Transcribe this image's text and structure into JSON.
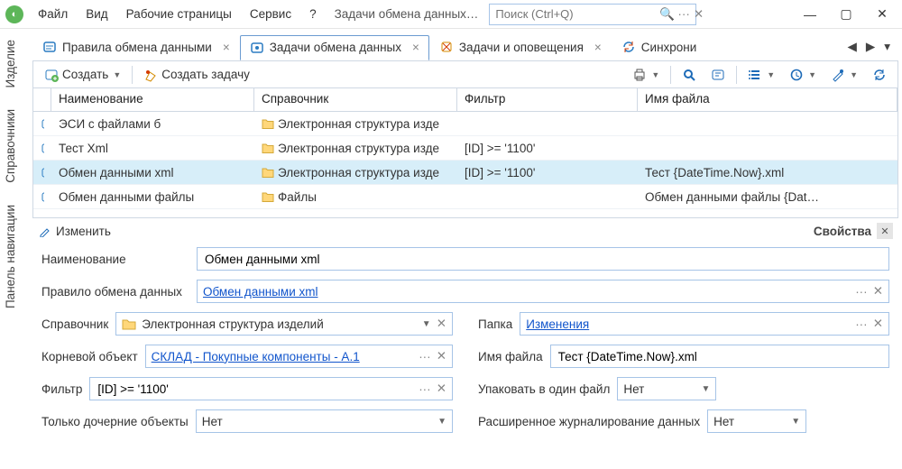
{
  "menu": {
    "file": "Файл",
    "view": "Вид",
    "pages": "Рабочие страницы",
    "service": "Сервис",
    "help": "?",
    "current": "Задачи обмена данных…"
  },
  "search": {
    "placeholder": "Поиск (Ctrl+Q)"
  },
  "window": {
    "min": "—",
    "max": "▢",
    "close": "✕"
  },
  "sidebar": {
    "items": [
      "Изделие",
      "Справочники",
      "Панель навигации"
    ]
  },
  "tabs": [
    {
      "label": "Правила обмена данными"
    },
    {
      "label": "Задачи обмена данных"
    },
    {
      "label": "Задачи и оповещения"
    },
    {
      "label": "Синхрони"
    }
  ],
  "toolbar": {
    "create": "Создать",
    "create_task": "Создать задачу"
  },
  "columns": [
    "Наименование",
    "Справочник",
    "Фильтр",
    "Имя файла"
  ],
  "rows": [
    {
      "name": "ЭСИ с файлами б",
      "ref": "Электронная структура изде",
      "filter": "",
      "file": ""
    },
    {
      "name": "Тест Xml",
      "ref": "Электронная структура изде",
      "filter": "[ID] >= '1100'",
      "file": ""
    },
    {
      "name": "Обмен данными xml",
      "ref": "Электронная структура изде",
      "filter": "[ID] >= '1100'",
      "file": "Тест {DateTime.Now}.xml"
    },
    {
      "name": "Обмен данными файлы",
      "ref": "Файлы",
      "filter": "",
      "file": "Обмен данными файлы {Dat…"
    }
  ],
  "props": {
    "edit": "Изменить",
    "title": "Свойства",
    "name_lbl": "Наименование",
    "name_val": "Обмен данными xml",
    "rule_lbl": "Правило обмена данных",
    "rule_val": "Обмен данными xml",
    "ref_lbl": "Справочник",
    "ref_val": "Электронная структура изделий",
    "folder_lbl": "Папка",
    "folder_val": "Изменения",
    "root_lbl": "Корневой объект",
    "root_val": "СКЛАД - Покупные компоненты - A.1",
    "file_lbl": "Имя файла",
    "file_val": "Тест {DateTime.Now}.xml",
    "filter_lbl": "Фильтр",
    "filter_val": "[ID] >= '1100'",
    "pack_lbl": "Упаковать в один файл",
    "pack_val": "Нет",
    "children_lbl": "Только дочерние объекты",
    "children_val": "Нет",
    "log_lbl": "Расширенное журналирование данных",
    "log_val": "Нет"
  }
}
